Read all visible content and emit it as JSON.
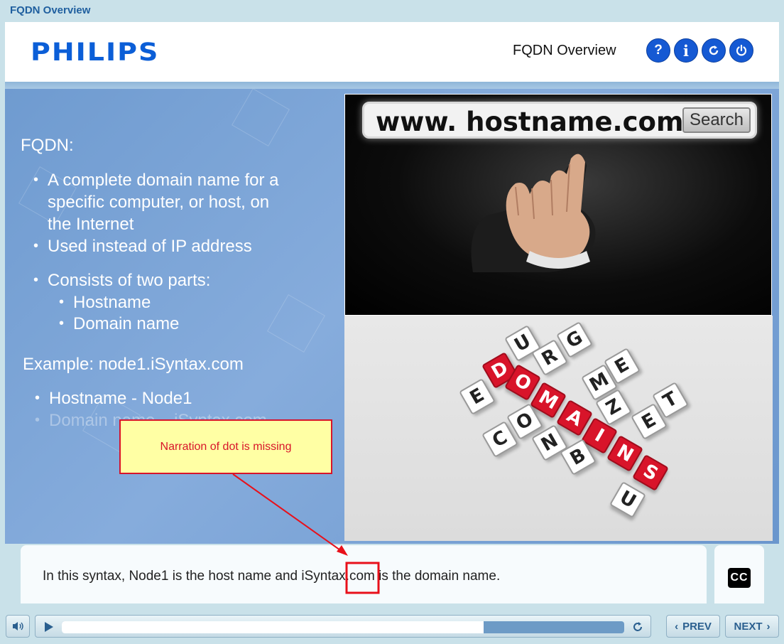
{
  "window": {
    "title": "FQDN Overview"
  },
  "header": {
    "logo": "PHILIPS",
    "title": "FQDN Overview",
    "buttons": {
      "help": "?",
      "info": "i"
    }
  },
  "slide": {
    "heading": "FQDN:",
    "bullets": [
      "A complete domain name for a",
      "specific computer, or host, on",
      "the Internet",
      "Used instead of IP address",
      "Consists of two parts:"
    ],
    "sub_bullets": [
      "Hostname",
      "Domain name"
    ],
    "example_heading": "Example: node1.iSyntax.com",
    "example_bullets": [
      "Hostname - Node1",
      "Domain name – iSyntax.com"
    ],
    "image_top": {
      "url_text": "www. hostname.com",
      "search_label": "Search"
    }
  },
  "annotation": {
    "text": "Narration of dot is missing",
    "color": "#d8142a"
  },
  "caption": {
    "text": "In this syntax, Node1 is the host name and iSyntax.com is the domain name."
  },
  "cc_label": "CC",
  "player": {
    "progress": 0.75
  },
  "nav": {
    "prev": "PREV",
    "next": "NEXT"
  },
  "colors": {
    "brand": "#0b5ed7",
    "accent": "#1559d3",
    "slide_bg": "#7aa4d6"
  }
}
